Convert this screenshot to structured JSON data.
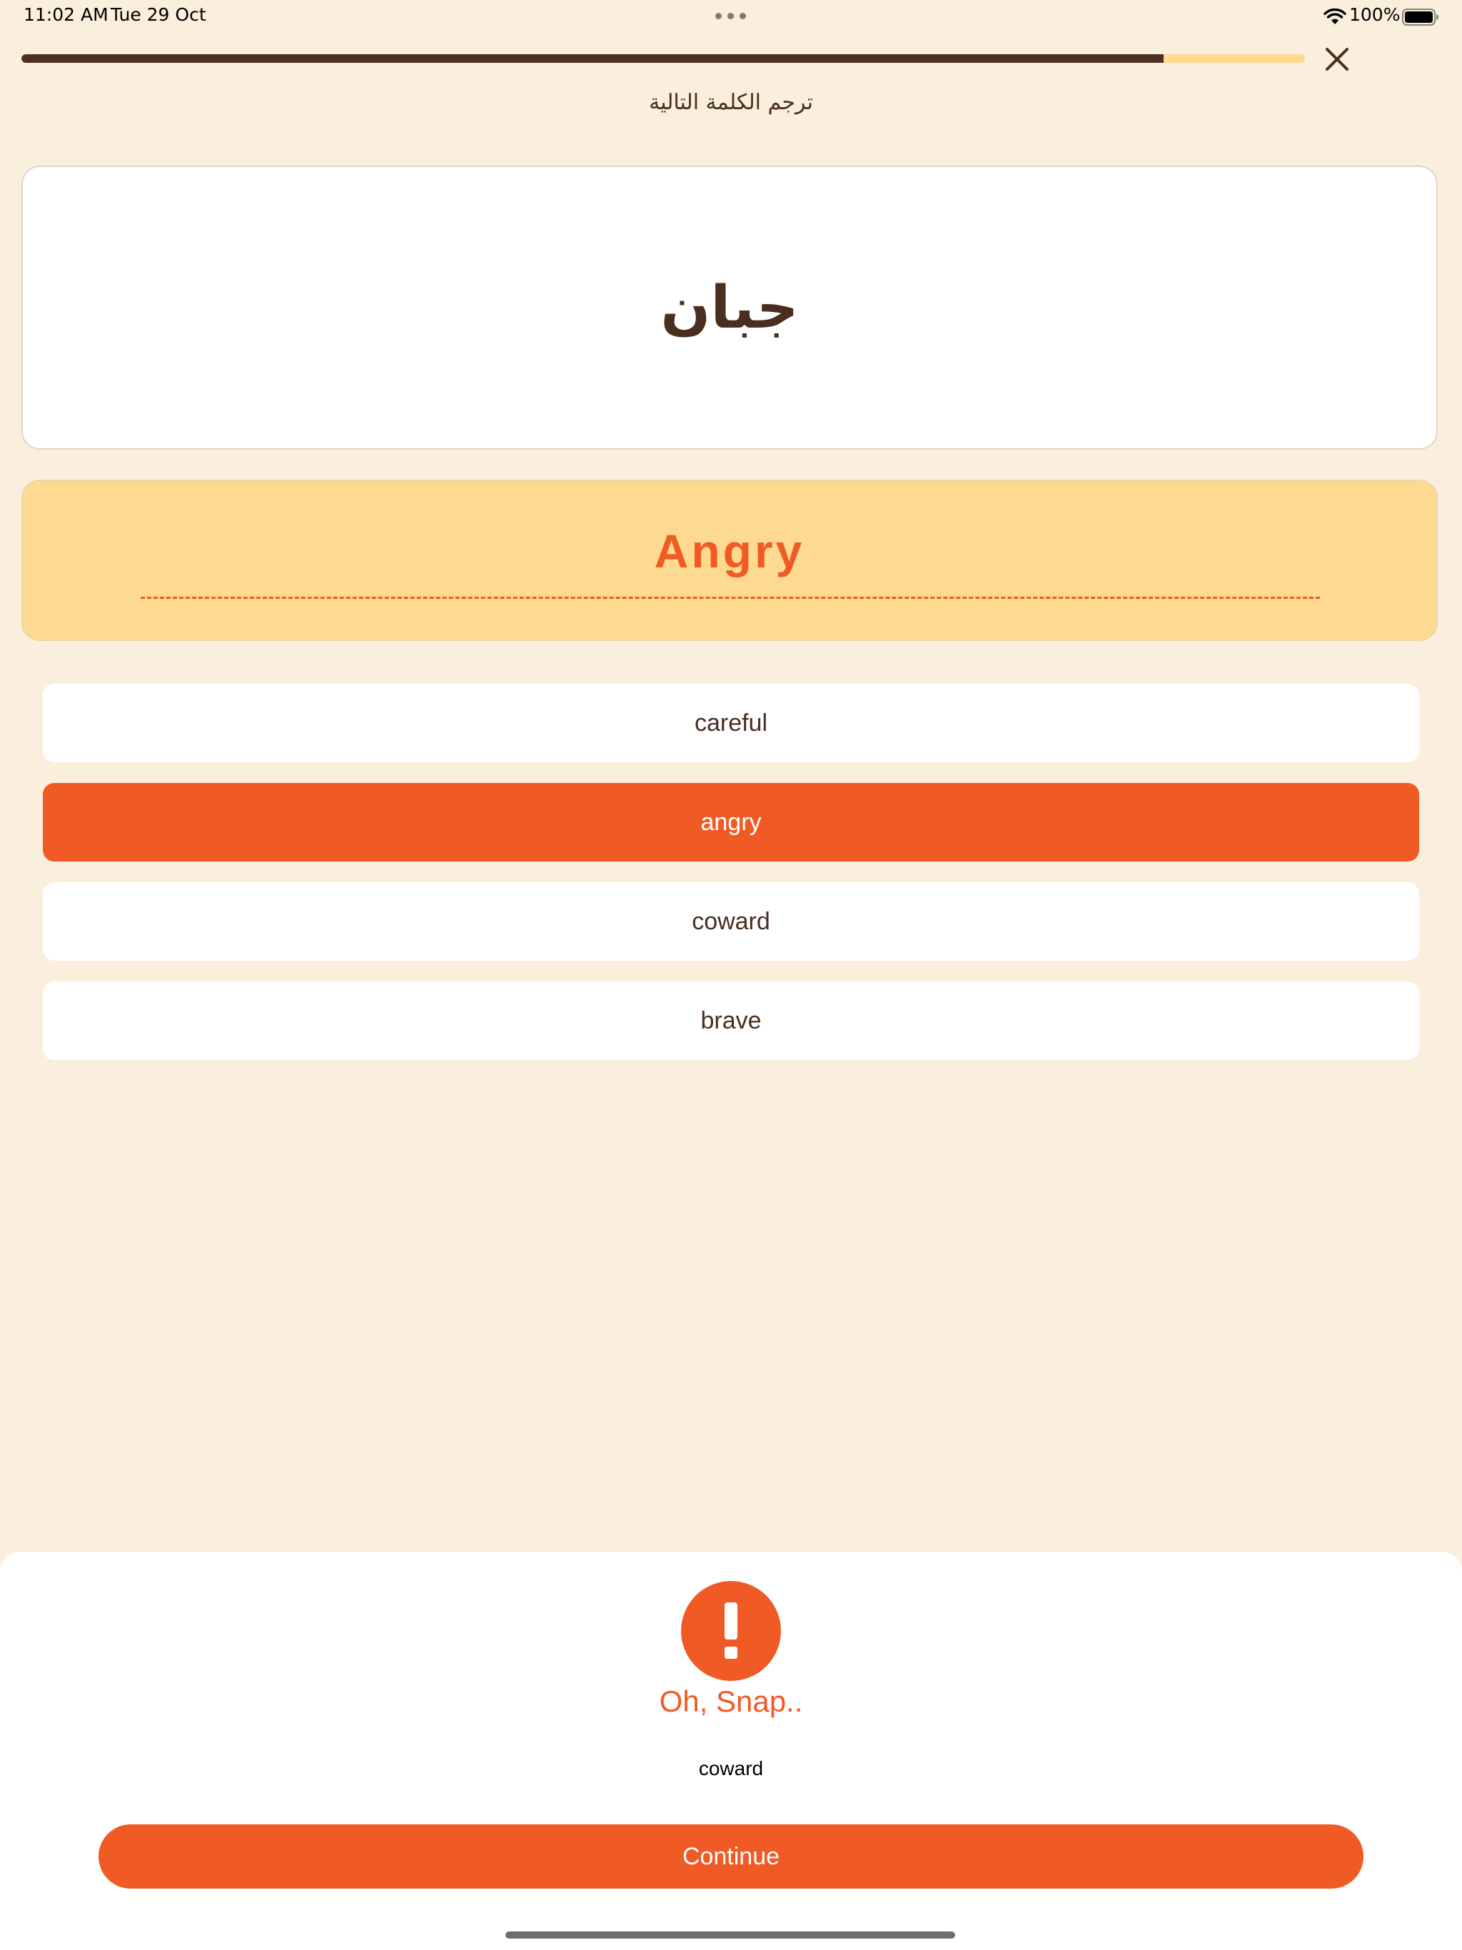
{
  "status_bar": {
    "time": "11:02 AM",
    "date": "Tue 29 Oct",
    "battery_percent": "100%",
    "icons": [
      "wifi-icon",
      "battery-icon",
      "multitasking-dots-icon"
    ]
  },
  "lesson": {
    "progress": 0.89,
    "close_icon": "close-icon"
  },
  "instruction": "ترجم الكلمة التالية",
  "question": {
    "word": "جبان"
  },
  "answer": {
    "selected_text": "Angry"
  },
  "options": [
    {
      "label": "careful",
      "selected": false
    },
    {
      "label": "angry",
      "selected": true
    },
    {
      "label": "coward",
      "selected": false
    },
    {
      "label": "brave",
      "selected": false
    }
  ],
  "feedback": {
    "icon": "exclamation-icon",
    "title": "Oh, Snap..",
    "correct_answer": "coward",
    "continue_label": "Continue"
  },
  "colors": {
    "background": "#FAEEDC",
    "accent": "#F05A24",
    "answer_card": "#FDDA90",
    "text": "#4A2E1F",
    "progress_fill": "#4E3023",
    "progress_track": "#FDDA90"
  }
}
